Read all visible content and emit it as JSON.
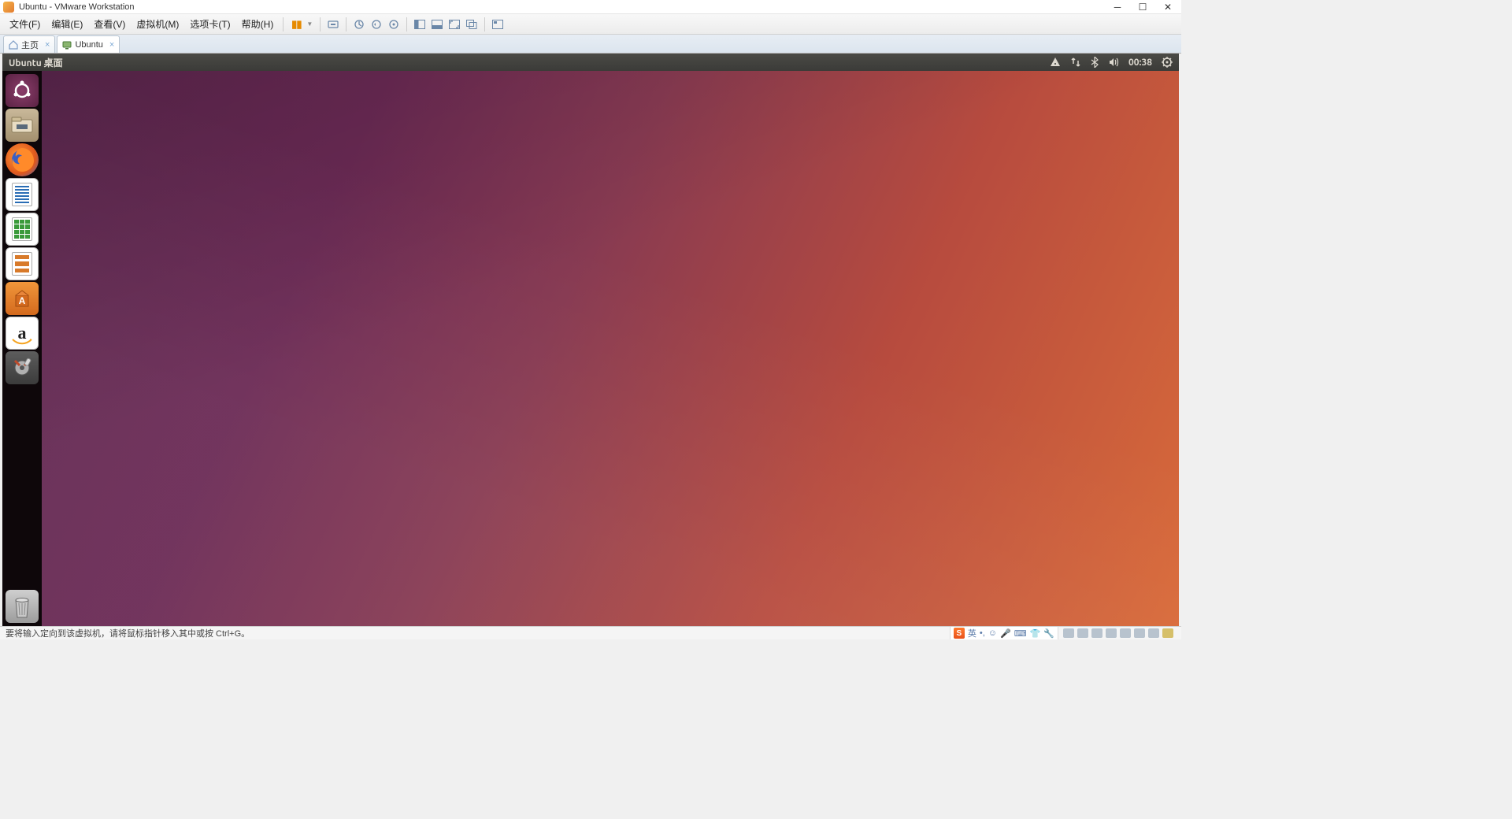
{
  "window": {
    "title": "Ubuntu - VMware Workstation"
  },
  "menubar": {
    "items": [
      "文件(F)",
      "编辑(E)",
      "查看(V)",
      "虚拟机(M)",
      "选项卡(T)",
      "帮助(H)"
    ]
  },
  "tabs": [
    {
      "label": "主页",
      "icon": "home",
      "active": false
    },
    {
      "label": "Ubuntu",
      "icon": "vm",
      "active": true
    }
  ],
  "ubuntu": {
    "panel_title": "Ubuntu 桌面",
    "time": "00:38",
    "launcher": [
      {
        "name": "dash",
        "icon": "ubuntu-logo"
      },
      {
        "name": "files",
        "icon": "files-icon"
      },
      {
        "name": "firefox",
        "icon": "firefox-icon"
      },
      {
        "name": "writer",
        "icon": "writer-icon"
      },
      {
        "name": "calc",
        "icon": "calc-icon"
      },
      {
        "name": "impress",
        "icon": "impress-icon"
      },
      {
        "name": "software",
        "icon": "software-icon"
      },
      {
        "name": "amazon",
        "icon": "amazon-icon",
        "glyph": "a"
      },
      {
        "name": "settings",
        "icon": "settings-icon"
      }
    ],
    "trash": {
      "name": "trash",
      "icon": "trash-icon"
    }
  },
  "statusbar": {
    "text": "要将输入定向到该虚拟机，请将鼠标指针移入其中或按 Ctrl+G。",
    "ime_lang": "英"
  }
}
